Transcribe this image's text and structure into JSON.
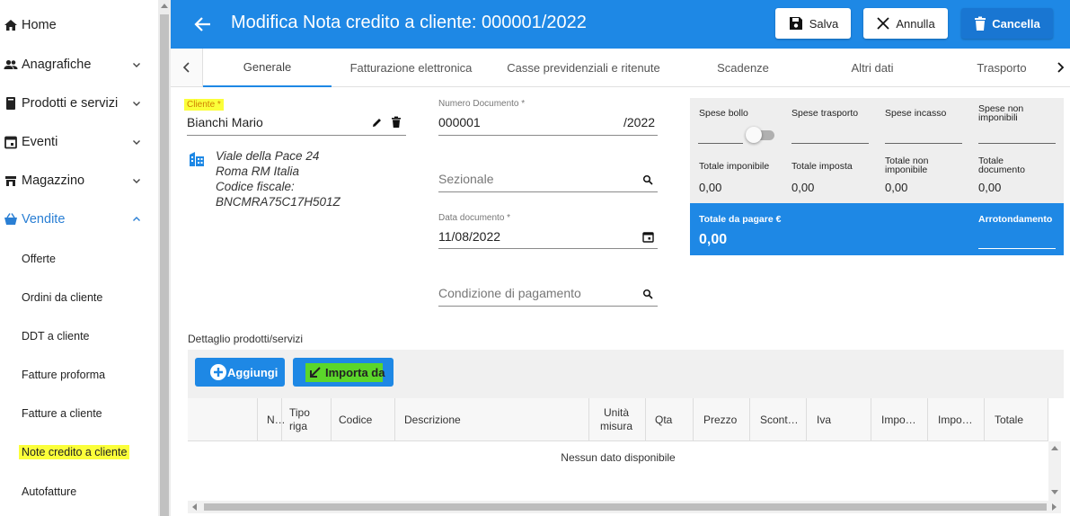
{
  "sidebar": {
    "items": [
      {
        "label": "Home",
        "icon": "home-icon"
      },
      {
        "label": "Anagrafiche",
        "icon": "people-icon"
      },
      {
        "label": "Prodotti e servizi",
        "icon": "book-icon"
      },
      {
        "label": "Eventi",
        "icon": "calendar-icon"
      },
      {
        "label": "Magazzino",
        "icon": "warehouse-icon"
      },
      {
        "label": "Vendite",
        "icon": "basket-icon"
      }
    ],
    "subitems": [
      {
        "label": "Offerte"
      },
      {
        "label": "Ordini da cliente"
      },
      {
        "label": "DDT a cliente"
      },
      {
        "label": "Fatture proforma"
      },
      {
        "label": "Fatture a cliente"
      },
      {
        "label": "Note credito a cliente"
      },
      {
        "label": "Autofatture"
      }
    ]
  },
  "header": {
    "title": "Modifica Nota credito a cliente: 000001/2022",
    "save_label": "Salva",
    "cancel_label": "Annulla",
    "delete_label": "Cancella"
  },
  "tabs": [
    {
      "label": "Generale"
    },
    {
      "label": "Fatturazione elettronica"
    },
    {
      "label": "Casse previdenziali e ritenute"
    },
    {
      "label": "Scadenze"
    },
    {
      "label": "Altri dati"
    },
    {
      "label": "Trasporto"
    }
  ],
  "form": {
    "cliente_label": "Cliente *",
    "cliente_value": "Bianchi Mario",
    "address": [
      "Viale della Pace 24",
      "Roma RM Italia",
      "Codice fiscale:",
      "BNCMRA75C17H501Z"
    ],
    "numero_label": "Numero Documento *",
    "numero_value": "000001",
    "numero_suffix": "/2022",
    "sezionale_placeholder": "Sezionale",
    "data_label": "Data documento *",
    "data_value": "11/08/2022",
    "condizione_placeholder": "Condizione di pagamento"
  },
  "totals": {
    "spese_bollo": "Spese bollo",
    "spese_trasporto": "Spese trasporto",
    "spese_incasso": "Spese incasso",
    "spese_non_imponibili": "Spese non imponibili",
    "totale_imponibile_label": "Totale imponibile",
    "totale_imponibile": "0,00",
    "totale_imposta_label": "Totale imposta",
    "totale_imposta": "0,00",
    "totale_non_imponibile_label": "Totale non imponibile",
    "totale_non_imponibile": "0,00",
    "totale_documento_label": "Totale documento",
    "totale_documento": "0,00",
    "da_pagare_label": "Totale da pagare €",
    "da_pagare": "0,00",
    "arrotondamento_label": "Arrotondamento"
  },
  "detail": {
    "title": "Dettaglio prodotti/servizi",
    "add_label": "Aggiungi",
    "import_label": "Importa da",
    "columns": [
      "N…",
      "Tipo riga",
      "Codice",
      "Descrizione",
      "Unità misura",
      "Qta",
      "Prezzo",
      "Scont…",
      "Iva",
      "Impo…",
      "Impo…",
      "Totale"
    ],
    "empty": "Nessun dato disponibile"
  },
  "colors": {
    "primary": "#1e88e5",
    "highlight": "#fbff3a",
    "import_highlight": "#5bd62a"
  }
}
